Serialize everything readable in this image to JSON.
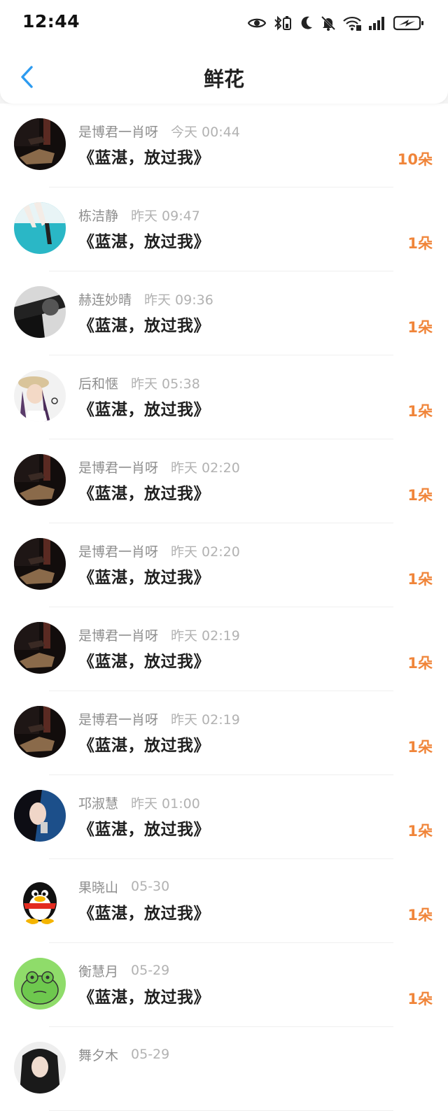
{
  "status": {
    "time": "12:44",
    "icons": [
      "eye-icon",
      "bluetooth-battery-icon",
      "moon-icon",
      "bell-off-icon",
      "wifi-icon",
      "signal-icon",
      "battery-charging-icon"
    ]
  },
  "nav": {
    "title": "鲜花",
    "back_icon": "chevron-left-icon"
  },
  "colors": {
    "accent": "#2d9bf0",
    "count": "#f0853a",
    "name": "#8e8e8e",
    "date": "#b2b2b2"
  },
  "items": [
    {
      "name": "是博君一肖呀",
      "date": "今天 00:44",
      "work": "《蓝湛，放过我》",
      "count": "10朵",
      "avatar": "dark-photo"
    },
    {
      "name": "栋洁静",
      "date": "昨天 09:47",
      "work": "《蓝湛，放过我》",
      "count": "1朵",
      "avatar": "teal-hands"
    },
    {
      "name": "赫连妙晴",
      "date": "昨天 09:36",
      "work": "《蓝湛，放过我》",
      "count": "1朵",
      "avatar": "bw-photo"
    },
    {
      "name": "后和惬",
      "date": "昨天 05:38",
      "work": "《蓝湛，放过我》",
      "count": "1朵",
      "avatar": "girl-hat"
    },
    {
      "name": "是博君一肖呀",
      "date": "昨天 02:20",
      "work": "《蓝湛，放过我》",
      "count": "1朵",
      "avatar": "dark-photo"
    },
    {
      "name": "是博君一肖呀",
      "date": "昨天 02:20",
      "work": "《蓝湛，放过我》",
      "count": "1朵",
      "avatar": "dark-photo"
    },
    {
      "name": "是博君一肖呀",
      "date": "昨天 02:19",
      "work": "《蓝湛，放过我》",
      "count": "1朵",
      "avatar": "dark-photo"
    },
    {
      "name": "是博君一肖呀",
      "date": "昨天 02:19",
      "work": "《蓝湛，放过我》",
      "count": "1朵",
      "avatar": "dark-photo"
    },
    {
      "name": "邛淑慧",
      "date": "昨天 01:00",
      "work": "《蓝湛，放过我》",
      "count": "1朵",
      "avatar": "girl-blue"
    },
    {
      "name": "果晓山",
      "date": "05-30",
      "work": "《蓝湛，放过我》",
      "count": "1朵",
      "avatar": "penguin"
    },
    {
      "name": "衡慧月",
      "date": "05-29",
      "work": "《蓝湛，放过我》",
      "count": "1朵",
      "avatar": "frog"
    },
    {
      "name": "舞夕木",
      "date": "05-29",
      "work": "",
      "count": "",
      "avatar": "girl-dark"
    }
  ]
}
